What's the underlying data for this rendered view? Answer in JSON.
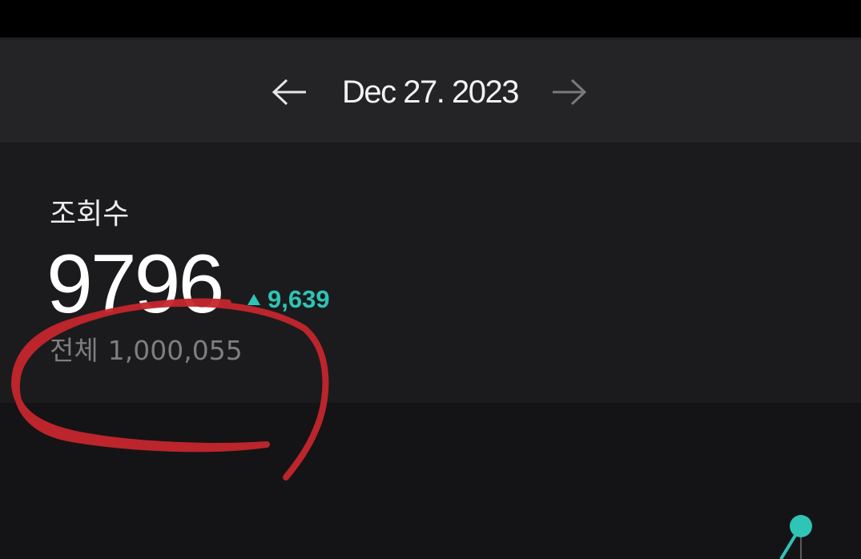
{
  "date_nav": {
    "date": "Dec 27. 2023"
  },
  "stats": {
    "metric_label": "조회수",
    "value": "9796",
    "delta": "9,639",
    "total_label": "전체",
    "total_value": "1,000,055"
  },
  "colors": {
    "background": "#141416",
    "date_bar": "#242426",
    "card": "#1b1b1d",
    "accent": "#2ec4b6",
    "annotation": "#c4262c"
  },
  "icons": {
    "prev": "arrow-left-icon",
    "next": "arrow-right-icon",
    "delta": "triangle-up-icon"
  }
}
